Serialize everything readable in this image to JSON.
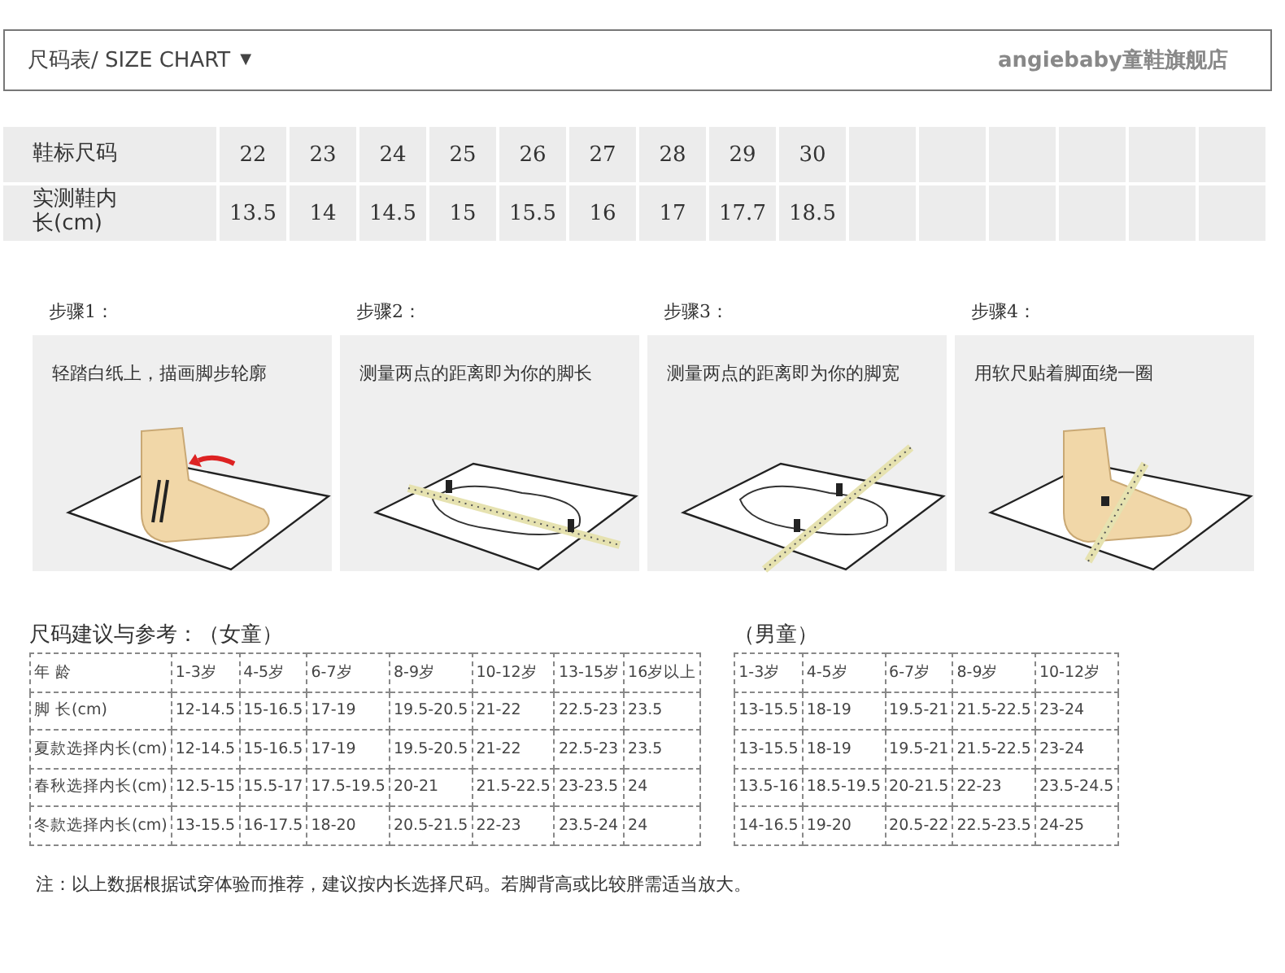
{
  "header": {
    "title": "尺码表/ SIZE CHART",
    "caret": "▼",
    "shop": "angiebaby童鞋旗舰店"
  },
  "size_table": {
    "rows": [
      {
        "label": "鞋标尺码",
        "values": [
          "22",
          "23",
          "24",
          "25",
          "26",
          "27",
          "28",
          "29",
          "30"
        ]
      },
      {
        "label": "实测鞋内长(cm)",
        "values": [
          "13.5",
          "14",
          "14.5",
          "15",
          "15.5",
          "16",
          "17",
          "17.7",
          "18.5"
        ]
      }
    ]
  },
  "steps": [
    {
      "title": "步骤1：",
      "caption": "轻踏白纸上，描画脚步轮廓",
      "kind": "trace"
    },
    {
      "title": "步骤2：",
      "caption": "测量两点的距离即为你的脚长",
      "kind": "length"
    },
    {
      "title": "步骤3：",
      "caption": "测量两点的距离即为你的脚宽",
      "kind": "width"
    },
    {
      "title": "步骤4：",
      "caption": "用软尺贴着脚面绕一圈",
      "kind": "girth"
    }
  ],
  "girls": {
    "title": "尺码建议与参考：（女童）",
    "rows": [
      [
        "年 龄",
        "1-3岁",
        "4-5岁",
        "6-7岁",
        "8-9岁",
        "10-12岁",
        "13-15岁",
        "16岁以上"
      ],
      [
        "脚 长(cm)",
        "12-14.5",
        "15-16.5",
        "17-19",
        "19.5-20.5",
        "21-22",
        "22.5-23",
        "23.5"
      ],
      [
        "夏款选择内长(cm)",
        "12-14.5",
        "15-16.5",
        "17-19",
        "19.5-20.5",
        "21-22",
        "22.5-23",
        "23.5"
      ],
      [
        "春秋选择内长(cm)",
        "12.5-15",
        "15.5-17",
        "17.5-19.5",
        "20-21",
        "21.5-22.5",
        "23-23.5",
        "24"
      ],
      [
        "冬款选择内长(cm)",
        "13-15.5",
        "16-17.5",
        "18-20",
        "20.5-21.5",
        "22-23",
        "23.5-24",
        "24"
      ]
    ]
  },
  "boys": {
    "title": "（男童）",
    "rows": [
      [
        "1-3岁",
        "4-5岁",
        "6-7岁",
        "8-9岁",
        "10-12岁"
      ],
      [
        "13-15.5",
        "18-19",
        "19.5-21",
        "21.5-22.5",
        "23-24"
      ],
      [
        "13-15.5",
        "18-19",
        "19.5-21",
        "21.5-22.5",
        "23-24"
      ],
      [
        "13.5-16",
        "18.5-19.5",
        "20-21.5",
        "22-23",
        "23.5-24.5"
      ],
      [
        "14-16.5",
        "19-20",
        "20.5-22",
        "22.5-23.5",
        "24-25"
      ]
    ]
  },
  "note": "注：以上数据根据试穿体验而推荐，建议按内长选择尺码。若脚背高或比较胖需适当放大。"
}
